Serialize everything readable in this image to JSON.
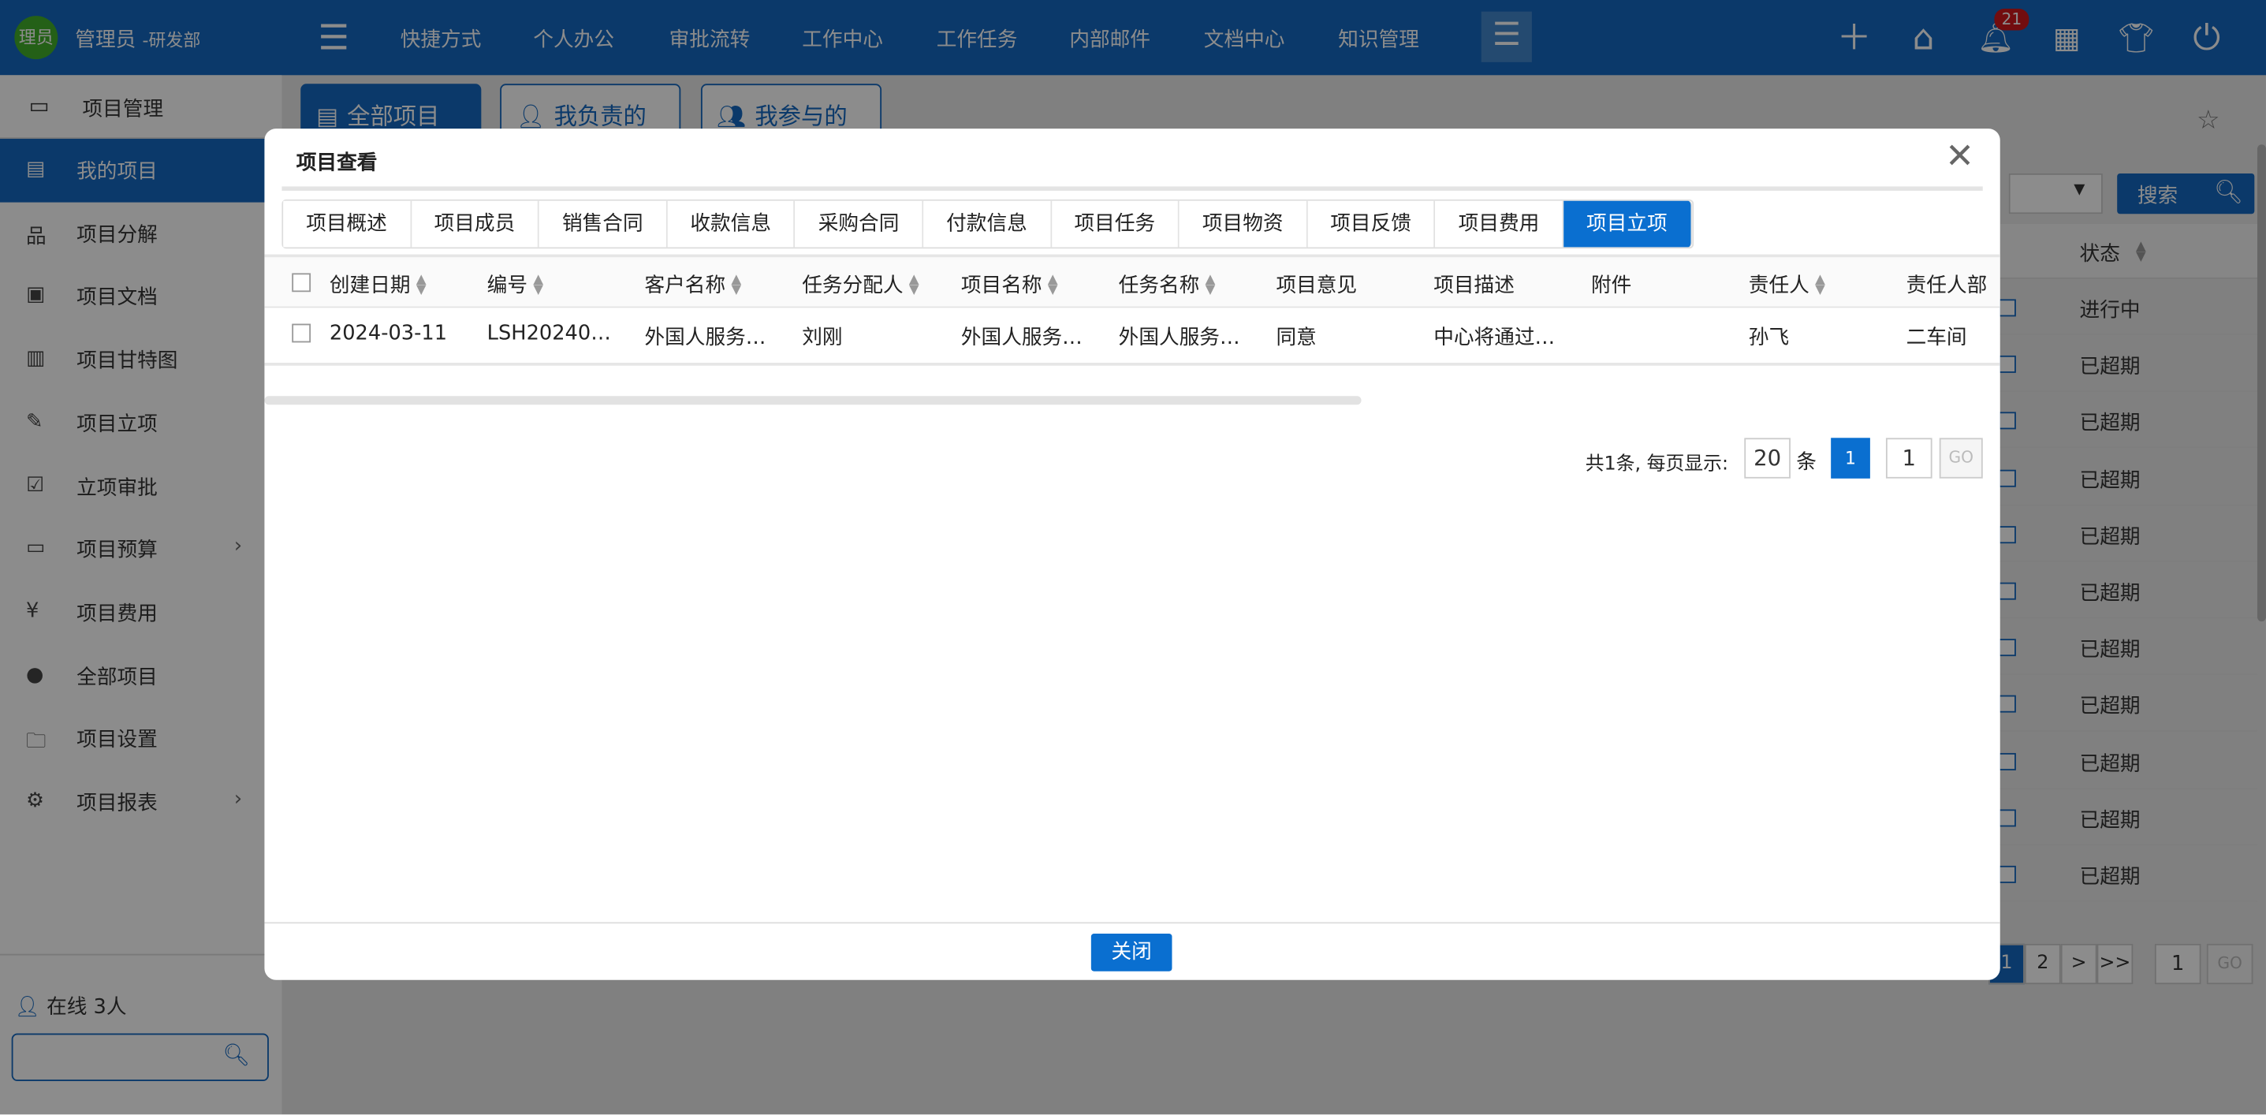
{
  "topbar": {
    "avatar_text": "理员",
    "user_name": "管理员",
    "department": "-研发部",
    "nav": [
      "快捷方式",
      "个人办公",
      "审批流转",
      "工作中心",
      "工作任务",
      "内部邮件",
      "文档中心",
      "知识管理"
    ],
    "notification_count": "21",
    "accent": "#1469c1"
  },
  "sidebar": {
    "title": "项目管理",
    "items": [
      {
        "label": "我的项目",
        "icon": "grid-icon",
        "active": true
      },
      {
        "label": "项目分解",
        "icon": "hierarchy-icon"
      },
      {
        "label": "项目文档",
        "icon": "document-icon"
      },
      {
        "label": "项目甘特图",
        "icon": "gantt-icon"
      },
      {
        "label": "项目立项",
        "icon": "pencil-icon"
      },
      {
        "label": "立项审批",
        "icon": "check-icon"
      },
      {
        "label": "项目预算",
        "icon": "monitor-icon",
        "has_submenu": true
      },
      {
        "label": "项目费用",
        "icon": "yen-icon"
      },
      {
        "label": "全部项目",
        "icon": "circle-icon"
      },
      {
        "label": "项目设置",
        "icon": "folder-gear-icon"
      },
      {
        "label": "项目报表",
        "icon": "gear-icon",
        "has_submenu": true
      }
    ],
    "online_text": "在线 3人"
  },
  "main": {
    "tabs": [
      "全部项目",
      "我负责的",
      "我参与的"
    ],
    "search_label": "搜索",
    "status_header": "状态",
    "statuses": [
      "进行中",
      "已超期",
      "已超期",
      "已超期",
      "已超期",
      "已超期",
      "已超期",
      "已超期",
      "已超期",
      "已超期",
      "已超期"
    ],
    "pagination": {
      "pages": [
        "1",
        "2",
        ">",
        ">>"
      ],
      "page_input": "1",
      "go": "GO"
    }
  },
  "modal": {
    "title": "项目查看",
    "tabs": [
      "项目概述",
      "项目成员",
      "销售合同",
      "收款信息",
      "采购合同",
      "付款信息",
      "项目任务",
      "项目物资",
      "项目反馈",
      "项目费用",
      "项目立项"
    ],
    "active_tab": "项目立项",
    "columns": [
      "创建日期",
      "编号",
      "客户名称",
      "任务分配人",
      "项目名称",
      "任务名称",
      "项目意见",
      "项目描述",
      "附件",
      "责任人",
      "责任人部"
    ],
    "rows": [
      [
        "2024-03-11",
        "LSH20240…",
        "外国人服务…",
        "刘刚",
        "外国人服务…",
        "外国人服务…",
        "同意",
        "中心将通过…",
        "",
        "孙飞",
        "二车间"
      ]
    ],
    "pagination": {
      "summary": "共1条, 每页显示:",
      "page_size": "20",
      "unit": "条",
      "current": "1",
      "page_input": "1",
      "go": "GO"
    },
    "close_label": "关闭"
  }
}
